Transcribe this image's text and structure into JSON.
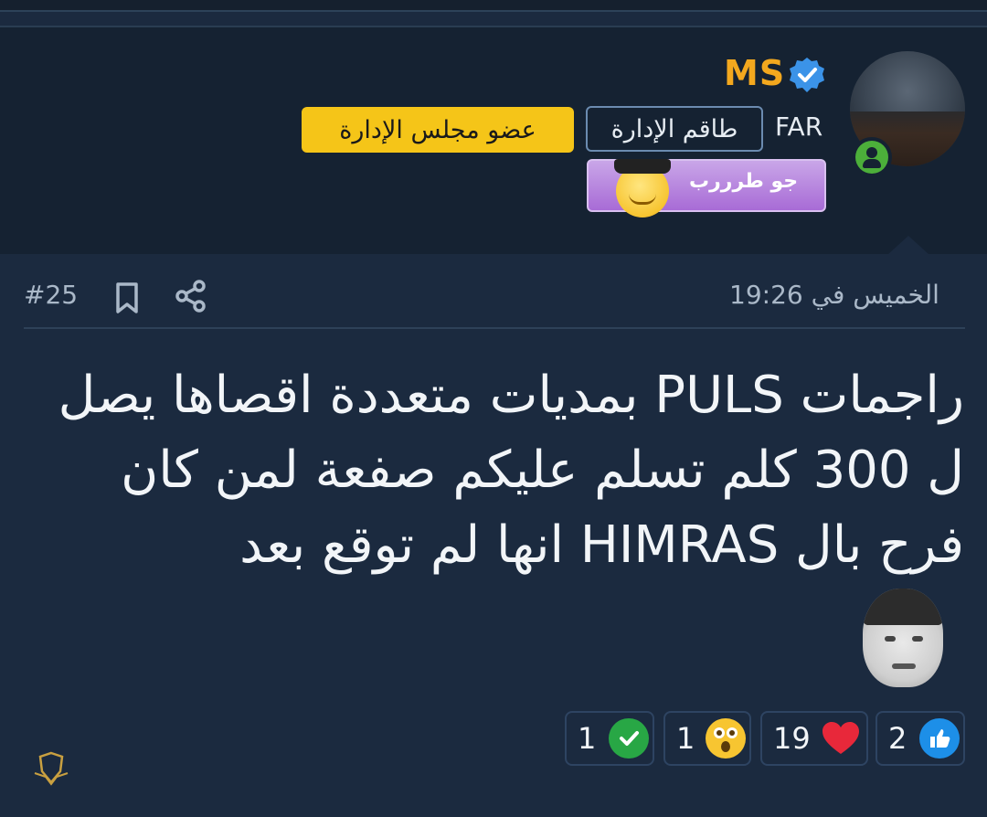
{
  "user": {
    "username": "MS",
    "verified_icon": "verified-check-icon",
    "tag": "FAR",
    "role_staff": "طاقم الإدارة",
    "role_board": "عضو مجلس الإدارة",
    "sticker_text": "جو طرررب",
    "online_icon": "user-online-icon"
  },
  "post": {
    "date": "الخميس في 19:26",
    "number": "#25",
    "body": "راجمات PULS بمديات متعددة اقصاها يصل ل 300 كلم تسلم عليكم صفعة لمن كان فرح بال HIMRAS انها لم توقع بعد",
    "bookmark_icon": "bookmark-icon",
    "share_icon": "share-icon"
  },
  "reactions": [
    {
      "icon": "thumbs-up-icon",
      "count": "2"
    },
    {
      "icon": "heart-icon",
      "count": "19"
    },
    {
      "icon": "shocked-face-icon",
      "count": "1"
    },
    {
      "icon": "checkmark-icon",
      "count": "1"
    }
  ],
  "watermark": {
    "icon": "forum-wings-logo-icon"
  },
  "colors": {
    "username": "#f3a81e",
    "board_badge": "#f5c518",
    "background": "#1b2a3f",
    "panel": "#152232",
    "heart": "#e8283a",
    "like": "#1d8fe8",
    "check": "#28a745"
  }
}
